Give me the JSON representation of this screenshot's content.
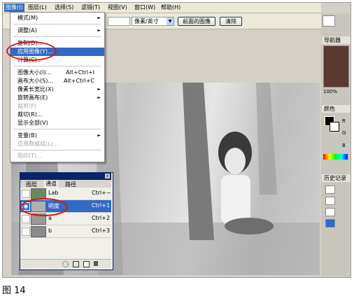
{
  "menubar": {
    "items": [
      "图像(I)",
      "图层(L)",
      "选择(S)",
      "滤镜(T)",
      "视图(V)",
      "窗口(W)",
      "帮助(H)"
    ],
    "active_index": 0
  },
  "optionsbar": {
    "unit_select": "像素/英寸",
    "front_image_button": "前面的图像",
    "clear_button": "清除"
  },
  "image_menu": {
    "items": [
      {
        "label": "模式(M)",
        "shortcut": "",
        "submenu": true,
        "disabled": false
      },
      {
        "label": "调整(A)",
        "shortcut": "",
        "submenu": true,
        "disabled": false
      },
      {
        "label": "复制(D)...",
        "shortcut": "",
        "submenu": false,
        "disabled": false
      },
      {
        "label": "应用图像(Y)...",
        "shortcut": "",
        "submenu": false,
        "disabled": false,
        "highlighted": true
      },
      {
        "label": "计算(C)...",
        "shortcut": "",
        "submenu": false,
        "disabled": false
      },
      {
        "label": "图像大小(I)...",
        "shortcut": "Alt+Ctrl+I",
        "submenu": false,
        "disabled": false
      },
      {
        "label": "画布大小(S)...",
        "shortcut": "Alt+Ctrl+C",
        "submenu": false,
        "disabled": false
      },
      {
        "label": "像素长宽比(X)",
        "shortcut": "",
        "submenu": true,
        "disabled": false
      },
      {
        "label": "旋转画布(E)",
        "shortcut": "",
        "submenu": true,
        "disabled": false
      },
      {
        "label": "裁剪(P)",
        "shortcut": "",
        "submenu": false,
        "disabled": true
      },
      {
        "label": "裁切(R)...",
        "shortcut": "",
        "submenu": false,
        "disabled": false
      },
      {
        "label": "显示全部(V)",
        "shortcut": "",
        "submenu": false,
        "disabled": false
      },
      {
        "label": "变量(B)",
        "shortcut": "",
        "submenu": true,
        "disabled": false
      },
      {
        "label": "应用数据组(L)...",
        "shortcut": "",
        "submenu": false,
        "disabled": true
      },
      {
        "label": "陷印(T)...",
        "shortcut": "",
        "submenu": false,
        "disabled": true
      }
    ]
  },
  "channels_panel": {
    "tabs": [
      "图层",
      "通道",
      "路径"
    ],
    "active_tab": 1,
    "rows": [
      {
        "name": "Lab",
        "shortcut": "Ctrl+~",
        "visible": false,
        "selected": false
      },
      {
        "name": "明度",
        "shortcut": "Ctrl+1",
        "visible": true,
        "selected": true
      },
      {
        "name": "a",
        "shortcut": "Ctrl+2",
        "visible": false,
        "selected": false
      },
      {
        "name": "b",
        "shortcut": "Ctrl+3",
        "visible": false,
        "selected": false
      }
    ]
  },
  "palettes": {
    "navigator_title": "导航器",
    "zoom": "100%",
    "color_title": "颜色",
    "channel_letters": [
      "R",
      "G",
      "B"
    ],
    "history_title": "历史记录"
  },
  "caption": "图 14",
  "colors": {
    "highlight": "#316ac5",
    "annotation": "#e01010"
  }
}
